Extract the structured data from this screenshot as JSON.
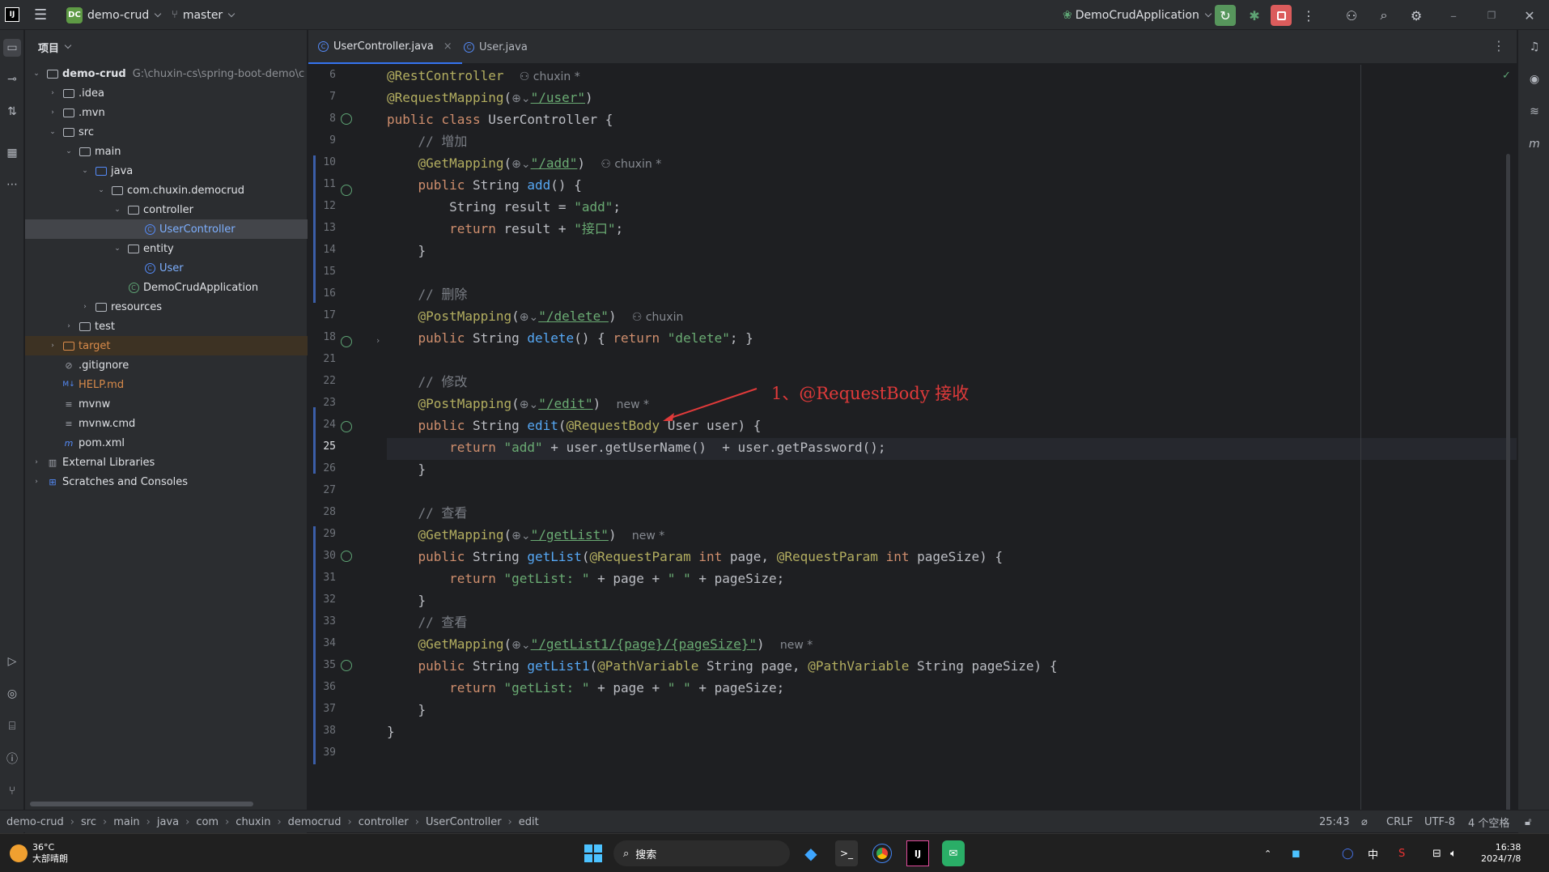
{
  "title_bar": {
    "project_badge": "DC",
    "project_name": "demo-crud",
    "branch": "master",
    "run_config": "DemoCrudApplication"
  },
  "project_panel": {
    "header": "项目",
    "tree": [
      {
        "label": "demo-crud",
        "hint": "G:\\chuxin-cs\\spring-boot-demo\\c",
        "icon": "module-folder-icon",
        "expanded": true
      },
      {
        "label": ".idea",
        "icon": "folder-icon"
      },
      {
        "label": ".mvn",
        "icon": "folder-icon"
      },
      {
        "label": "src",
        "icon": "folder-icon",
        "expanded": true
      },
      {
        "label": "main",
        "icon": "folder-icon",
        "expanded": true
      },
      {
        "label": "java",
        "icon": "source-folder-icon",
        "expanded": true
      },
      {
        "label": "com.chuxin.democrud",
        "icon": "package-icon",
        "expanded": true
      },
      {
        "label": "controller",
        "icon": "package-icon",
        "expanded": true
      },
      {
        "label": "UserController",
        "icon": "class-icon",
        "selected": true
      },
      {
        "label": "entity",
        "icon": "package-icon",
        "expanded": true
      },
      {
        "label": "User",
        "icon": "class-icon"
      },
      {
        "label": "DemoCrudApplication",
        "icon": "spring-class-icon"
      },
      {
        "label": "resources",
        "icon": "folder-icon"
      },
      {
        "label": "test",
        "icon": "folder-icon"
      },
      {
        "label": "target",
        "icon": "excluded-folder-icon"
      },
      {
        "label": ".gitignore",
        "icon": "ignore-file-icon"
      },
      {
        "label": "HELP.md",
        "icon": "markdown-icon"
      },
      {
        "label": "mvnw",
        "icon": "file-icon"
      },
      {
        "label": "mvnw.cmd",
        "icon": "file-icon"
      },
      {
        "label": "pom.xml",
        "icon": "maven-icon"
      },
      {
        "label": "External Libraries",
        "icon": "library-icon"
      },
      {
        "label": "Scratches and Consoles",
        "icon": "scratches-icon"
      }
    ]
  },
  "editor": {
    "tabs": [
      {
        "label": "UserController.java",
        "active": true,
        "closable": "×"
      },
      {
        "label": "User.java",
        "active": false
      }
    ],
    "line_numbers": [
      "6",
      "7",
      "8",
      "9",
      "10",
      "11",
      "12",
      "13",
      "14",
      "15",
      "16",
      "17",
      "18",
      "21",
      "22",
      "23",
      "24",
      "25",
      "26",
      "27",
      "28",
      "29",
      "30",
      "31",
      "32",
      "33",
      "34",
      "35",
      "36",
      "37",
      "38",
      "39"
    ],
    "current_line": "25",
    "annotation": "1、@RequestBody 接收"
  },
  "status_bar": {
    "breadcrumbs": [
      "demo-crud",
      "src",
      "main",
      "java",
      "com",
      "chuxin",
      "democrud",
      "controller",
      "UserController",
      "edit"
    ],
    "position": "25:43",
    "line_sep": "CRLF",
    "encoding": "UTF-8",
    "indent": "4 个空格"
  },
  "taskbar": {
    "weather_temp": "36°C",
    "weather_desc": "大部晴朗",
    "search_label": "搜索",
    "ime": "中",
    "time": "16:38",
    "date": "2024/7/8"
  }
}
